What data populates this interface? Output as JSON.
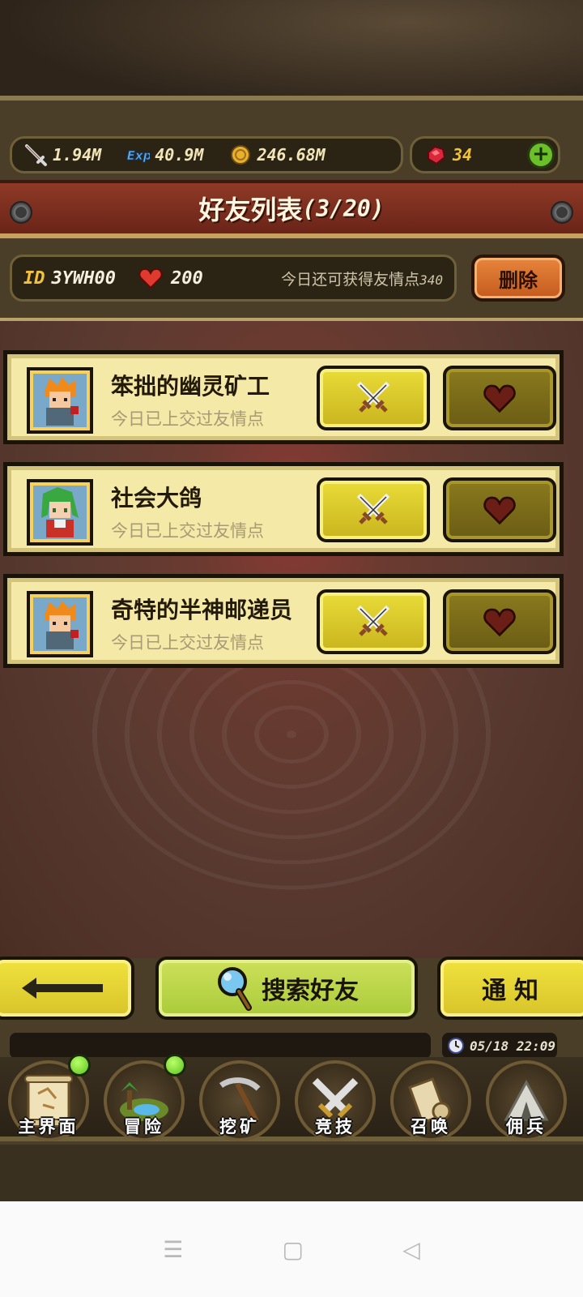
{
  "currency": {
    "attack": "1.94M",
    "exp": "40.9M",
    "gold": "246.68M",
    "gems": "34",
    "add": "+"
  },
  "title": {
    "text": "好友列表",
    "count": "(3/20)"
  },
  "profile": {
    "id_label": "ID",
    "id_value": "3YWH00",
    "friend_points": "200",
    "today_text": "今日还可获得友情点",
    "today_value": "340",
    "delete_label": "删除"
  },
  "friends": [
    {
      "name": "笨拙的幽灵矿工",
      "status": "今日已上交过友情点"
    },
    {
      "name": "社会大鸽",
      "status": "今日已上交过友情点"
    },
    {
      "name": "奇特的半神邮递员",
      "status": "今日已上交过友情点"
    }
  ],
  "controls": {
    "search_label": "搜索好友",
    "notice_label": "通知",
    "datetime": "05/18 22:09"
  },
  "nav": [
    {
      "label": "主界面",
      "badge": true
    },
    {
      "label": "冒险",
      "badge": true
    },
    {
      "label": "挖矿",
      "badge": false
    },
    {
      "label": "竞技",
      "badge": false
    },
    {
      "label": "召唤",
      "badge": false
    },
    {
      "label": "佣兵",
      "badge": false
    }
  ],
  "colors": {
    "title_banner": "#8e3a26",
    "yellow_button": "#e9dc38",
    "heart_button": "#8a7a1e",
    "delete_button": "#e8853c",
    "badge": "#5cc21a"
  }
}
